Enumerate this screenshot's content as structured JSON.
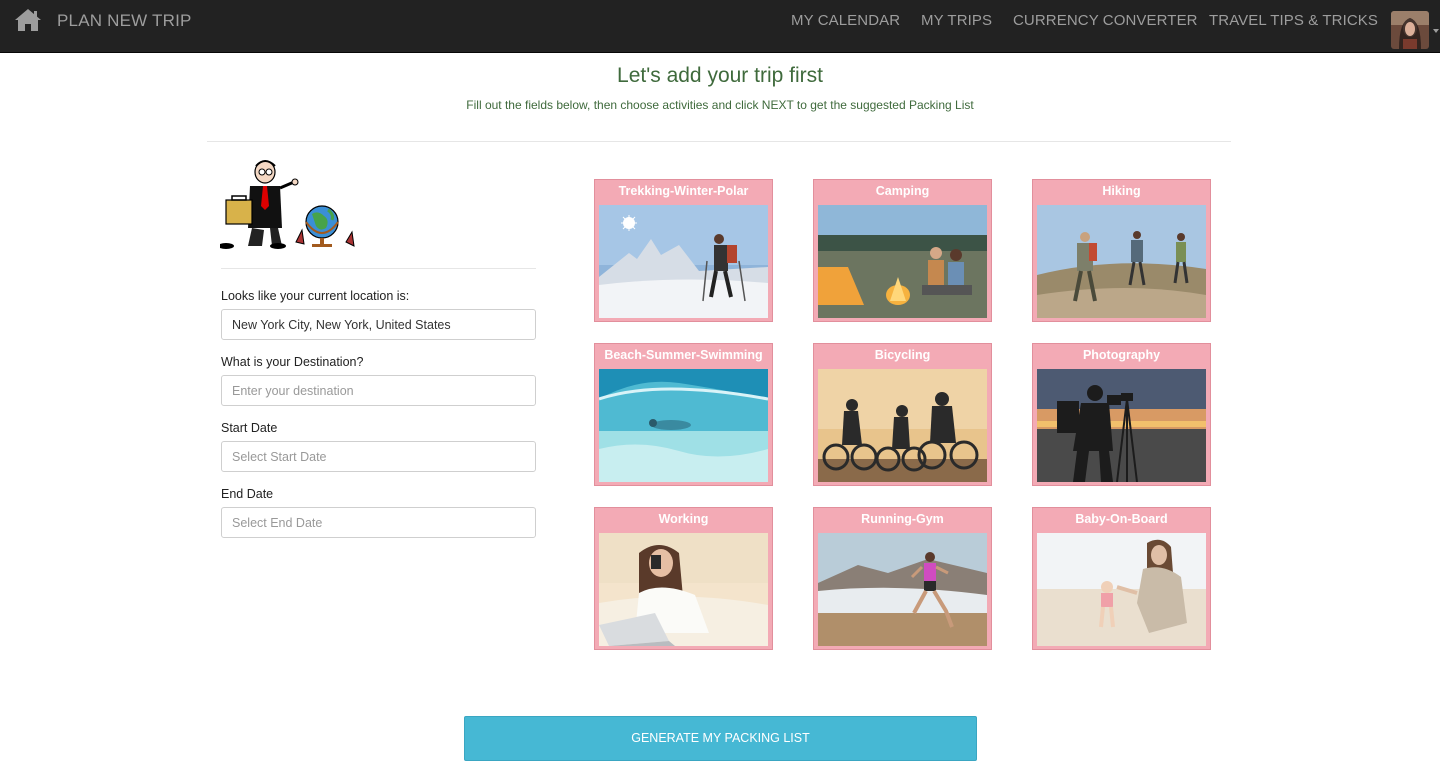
{
  "nav": {
    "brand": "PLAN NEW TRIP",
    "items": [
      {
        "label": "MY CALENDAR"
      },
      {
        "label": "MY TRIPS"
      },
      {
        "label": "CURRENCY CONVERTER"
      },
      {
        "label": "TRAVEL TIPS & TRICKS"
      }
    ],
    "home_icon": "home-icon",
    "avatar": "user-avatar",
    "colors": {
      "bar": "#222222",
      "text": "#9d9d9d"
    }
  },
  "header": {
    "title": "Let's add your trip first",
    "subtitle": "Fill out the fields below, then choose activities and click NEXT to get the suggested Packing List"
  },
  "form": {
    "location": {
      "label": "Looks like your current location is:",
      "value": "New York City, New York, United States"
    },
    "destination": {
      "label": "What is your Destination?",
      "placeholder": "Enter your destination"
    },
    "start_date": {
      "label": "Start Date",
      "placeholder": "Select Start Date"
    },
    "end_date": {
      "label": "End Date",
      "placeholder": "Select End Date"
    }
  },
  "activities": [
    {
      "label": "Trekking-Winter-Polar"
    },
    {
      "label": "Camping"
    },
    {
      "label": "Hiking"
    },
    {
      "label": "Beach-Summer-Swimming"
    },
    {
      "label": "Bicycling"
    },
    {
      "label": "Photography"
    },
    {
      "label": "Working"
    },
    {
      "label": "Running-Gym"
    },
    {
      "label": "Baby-On-Board"
    }
  ],
  "button": {
    "label": "GENERATE MY PACKING LIST"
  },
  "colors": {
    "accent": "#46b8d4",
    "card": "#f3aab5",
    "title": "#3f6a3c"
  }
}
